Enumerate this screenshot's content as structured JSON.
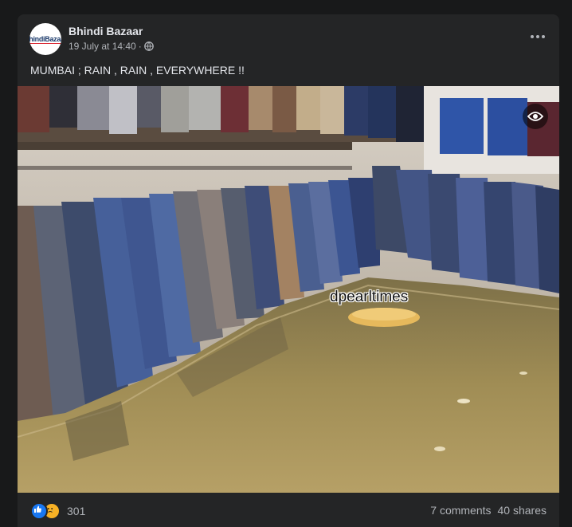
{
  "post": {
    "page_name": "Bhindi Bazaar",
    "avatar_text": "BhindiBazaar",
    "date": "19 July at 14:40",
    "separator": "·",
    "text": "MUMBAI ; RAIN , RAIN , EVERYWHERE !!",
    "watermark": "dpearltimes"
  },
  "footer": {
    "reaction_count": "301",
    "comments": "7 comments",
    "shares": "40 shares"
  },
  "icons": {
    "privacy": "globe-icon",
    "more": "more-options-icon",
    "view": "eye-icon",
    "reactions": [
      "like-icon",
      "sad-icon"
    ]
  },
  "colors": {
    "background": "#18191a",
    "card": "#242526",
    "primary_text": "#e4e6eb",
    "secondary_text": "#b0b3b8",
    "like_blue": "#1877f2",
    "sad_yellow": "#f7b125"
  }
}
